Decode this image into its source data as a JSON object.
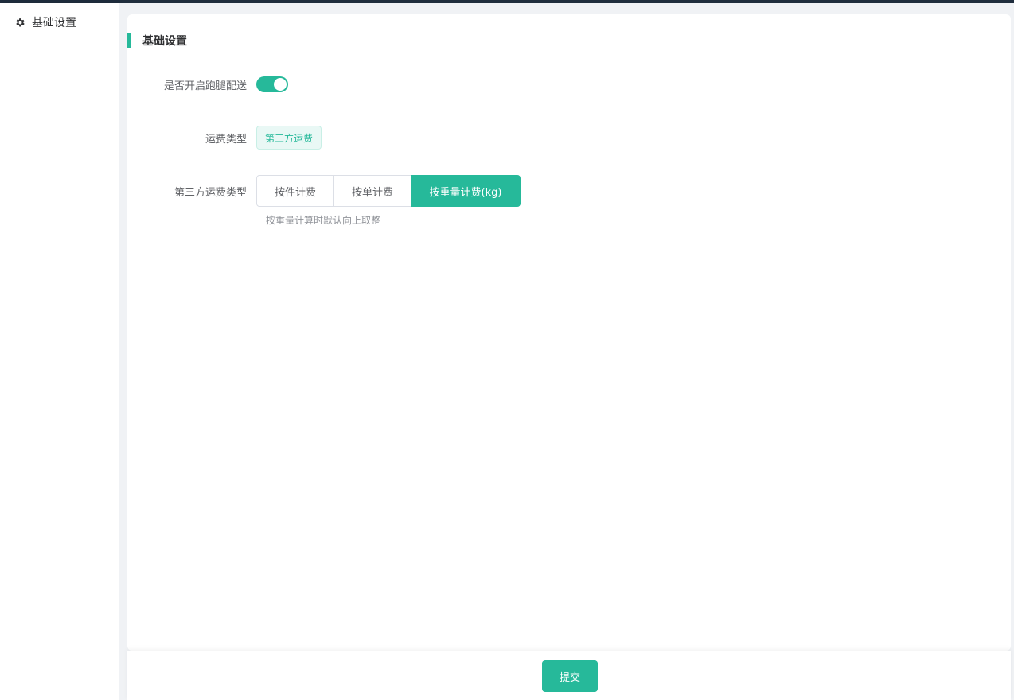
{
  "sidebar": {
    "items": [
      {
        "label": "基础设置",
        "icon": "gear-icon"
      }
    ]
  },
  "section": {
    "title": "基础设置"
  },
  "form": {
    "delivery_switch": {
      "label": "是否开启跑腿配送",
      "value": true
    },
    "fee_type": {
      "label": "运费类型",
      "value": "第三方运费"
    },
    "third_party_fee_type": {
      "label": "第三方运费类型",
      "options": [
        "按件计费",
        "按单计费",
        "按重量计费(kg)"
      ],
      "selected": "按重量计费(kg)",
      "hint": "按重量计算时默认向上取整"
    }
  },
  "footer": {
    "submit_label": "提交"
  },
  "colors": {
    "accent": "#26b99a",
    "topbar": "#1f2d3d"
  }
}
